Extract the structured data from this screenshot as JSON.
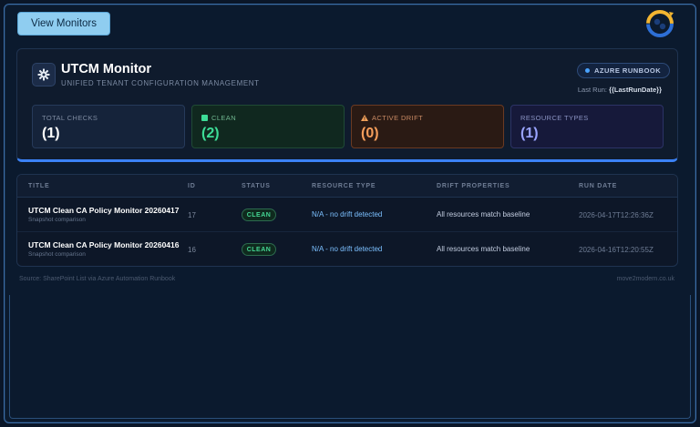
{
  "toolbar": {
    "view_monitors_label": "View Monitors"
  },
  "header": {
    "title": "UTCM Monitor",
    "subtitle": "UNIFIED TENANT CONFIGURATION MANAGEMENT",
    "badge": "AZURE RUNBOOK",
    "last_run_label": "Last Run:",
    "last_run_value": "{{LastRunDate}}"
  },
  "stats": {
    "total": {
      "label": "TOTAL CHECKS",
      "value": "(1)"
    },
    "clean": {
      "label": "CLEAN",
      "value": "(2)"
    },
    "drift": {
      "label": "ACTIVE DRIFT",
      "value": "(0)"
    },
    "types": {
      "label": "RESOURCE TYPES",
      "value": "(1)"
    }
  },
  "table": {
    "columns": [
      "TITLE",
      "ID",
      "STATUS",
      "RESOURCE TYPE",
      "DRIFT PROPERTIES",
      "RUN DATE"
    ],
    "rows": [
      {
        "title": "UTCM Clean CA Policy Monitor 20260417",
        "subtitle": "Snapshot comparison",
        "id": "17",
        "status": "CLEAN",
        "resource_type": "N/A - no drift detected",
        "drift_properties": "All resources match baseline",
        "run_date": "2026-04-17T12:26:36Z"
      },
      {
        "title": "UTCM Clean CA Policy Monitor 20260416",
        "subtitle": "Snapshot comparison",
        "id": "16",
        "status": "CLEAN",
        "resource_type": "N/A - no drift detected",
        "drift_properties": "All resources match baseline",
        "run_date": "2026-04-16T12:20:55Z"
      }
    ]
  },
  "footer": {
    "source": "Source: SharePoint List via Azure Automation Runbook",
    "site": "move2modern.co.uk"
  },
  "colors": {
    "accent": "#3b82f6",
    "clean": "#3ddc97",
    "drift": "#f59e5b",
    "types": "#9aa4ff"
  }
}
